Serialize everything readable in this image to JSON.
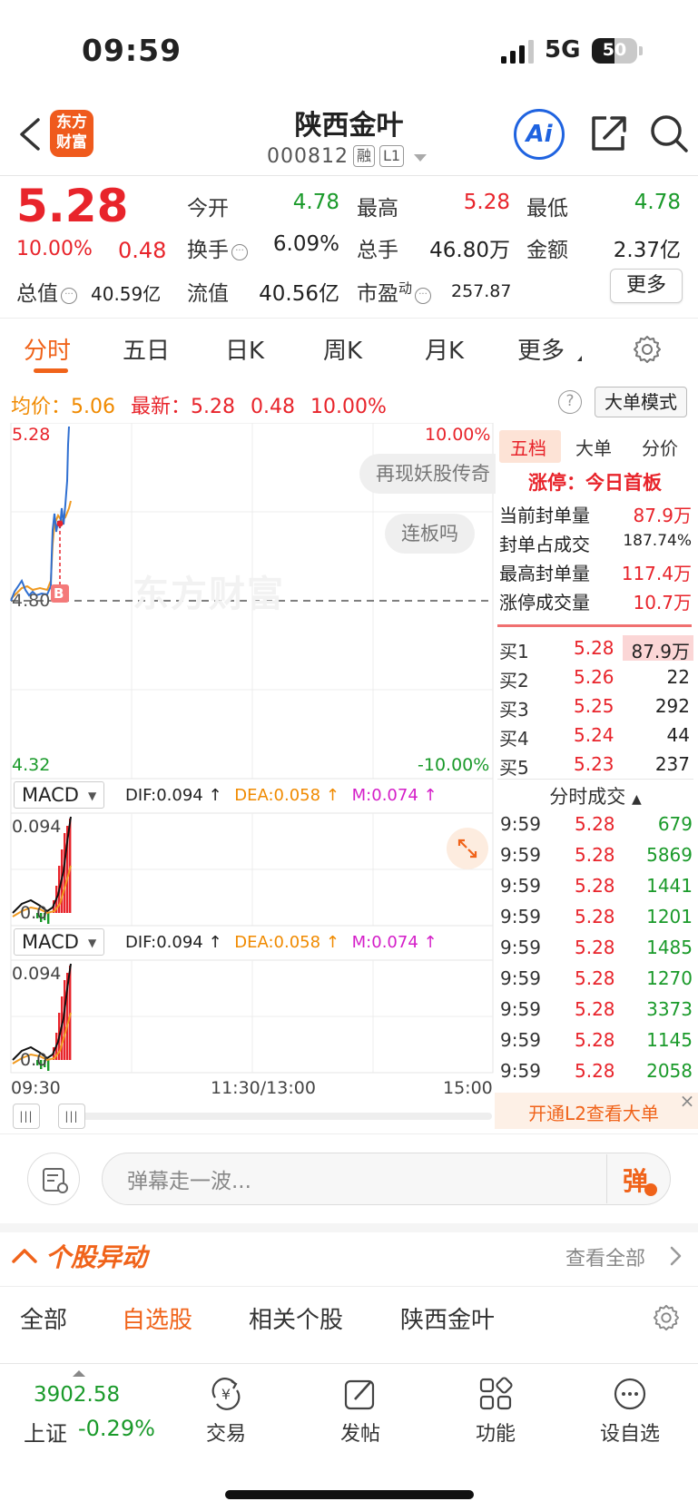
{
  "status": {
    "time": "09:59",
    "network": "5G",
    "battery": "50",
    "battery_level": 0.5
  },
  "header": {
    "logo": "东方财富",
    "title": "陕西金叶",
    "code": "000812",
    "tag_margin": "融",
    "tag_level": "L1",
    "ai_label": "Ai"
  },
  "quote": {
    "price": "5.28",
    "pct": "10.00%",
    "change": "0.48",
    "open_label": "今开",
    "open": "4.78",
    "high_label": "最高",
    "high": "5.28",
    "low_label": "最低",
    "low": "4.78",
    "turnover_label": "换手",
    "turnover": "6.09%",
    "volume_label": "总手",
    "volume": "46.80万",
    "amount_label": "金额",
    "amount": "2.37亿",
    "mktcap_label": "总值",
    "mktcap": "40.59亿",
    "float_label": "流值",
    "float": "40.56亿",
    "pe_label": "市盈",
    "pe_sup": "动",
    "pe": "257.87",
    "more": "更多"
  },
  "tabs": [
    "分时",
    "五日",
    "日K",
    "周K",
    "月K",
    "更多"
  ],
  "avg_row": {
    "avg_label": "均价：",
    "avg": "5.06",
    "latest_label": "最新：",
    "latest": "5.28",
    "change": "0.48",
    "pct": "10.00%",
    "big_mode": "大单模式"
  },
  "chart": {
    "price_top": "5.28",
    "pct_top": "10.00%",
    "price_bottom": "4.32",
    "pct_bottom": "-10.00%",
    "ref_price": "4.80",
    "buy_marker": "B",
    "bubble1": "再现妖股传奇",
    "bubble2": "连板吗",
    "watermark": "东方财富",
    "macd1": {
      "name": "MACD",
      "dif": "DIF:0.094 ↑",
      "dea": "DEA:0.058 ↑",
      "m": "M:0.074 ↑",
      "max": "0.094",
      "min": "0.0"
    },
    "macd2": {
      "name": "MACD",
      "dif": "DIF:0.094 ↑",
      "dea": "DEA:0.058 ↑",
      "m": "M:0.074 ↑",
      "max": "0.094",
      "min": "0.0"
    },
    "time_start": "09:30",
    "time_mid": "11:30/13:00",
    "time_end": "15:00"
  },
  "right_panel": {
    "tabs": [
      "五档",
      "大单",
      "分价"
    ],
    "limit_title": "涨停：今日首板",
    "limit_rows": [
      {
        "label": "当前封单量",
        "value": "87.9万"
      },
      {
        "label": "封单占成交",
        "value": "187.74%"
      },
      {
        "label": "最高封单量",
        "value": "117.4万"
      },
      {
        "label": "涨停成交量",
        "value": "10.7万"
      }
    ],
    "order_book": [
      {
        "label": "买1",
        "price": "5.28",
        "vol": "87.9万"
      },
      {
        "label": "买2",
        "price": "5.26",
        "vol": "22"
      },
      {
        "label": "买3",
        "price": "5.25",
        "vol": "292"
      },
      {
        "label": "买4",
        "price": "5.24",
        "vol": "44"
      },
      {
        "label": "买5",
        "price": "5.23",
        "vol": "237"
      }
    ],
    "ticks_title": "分时成交",
    "ticks": [
      {
        "t": "9:59",
        "p": "5.28",
        "v": "679"
      },
      {
        "t": "9:59",
        "p": "5.28",
        "v": "5869"
      },
      {
        "t": "9:59",
        "p": "5.28",
        "v": "1441"
      },
      {
        "t": "9:59",
        "p": "5.28",
        "v": "1201"
      },
      {
        "t": "9:59",
        "p": "5.28",
        "v": "1485"
      },
      {
        "t": "9:59",
        "p": "5.28",
        "v": "1270"
      },
      {
        "t": "9:59",
        "p": "5.28",
        "v": "3373"
      },
      {
        "t": "9:59",
        "p": "5.28",
        "v": "1145"
      },
      {
        "t": "9:59",
        "p": "5.28",
        "v": "2058"
      }
    ],
    "l2_banner": "开通L2查看大单"
  },
  "danmaku": {
    "placeholder": "弹幕走一波...",
    "send": "弹"
  },
  "movement": {
    "title": "个股异动",
    "view_all": "查看全部",
    "tabs": [
      "全部",
      "自选股",
      "相关个股",
      "陕西金叶"
    ]
  },
  "bottom_bar": {
    "index_value": "3902.58",
    "index_name": "上证",
    "index_pct": "-0.29%",
    "items": [
      "交易",
      "发帖",
      "功能",
      "设自选"
    ]
  },
  "colors": {
    "up": "#e8242b",
    "down": "#1a9a2a",
    "accent": "#f0631a",
    "avg_line": "#f09a20",
    "price_line": "#2f6fd1"
  }
}
